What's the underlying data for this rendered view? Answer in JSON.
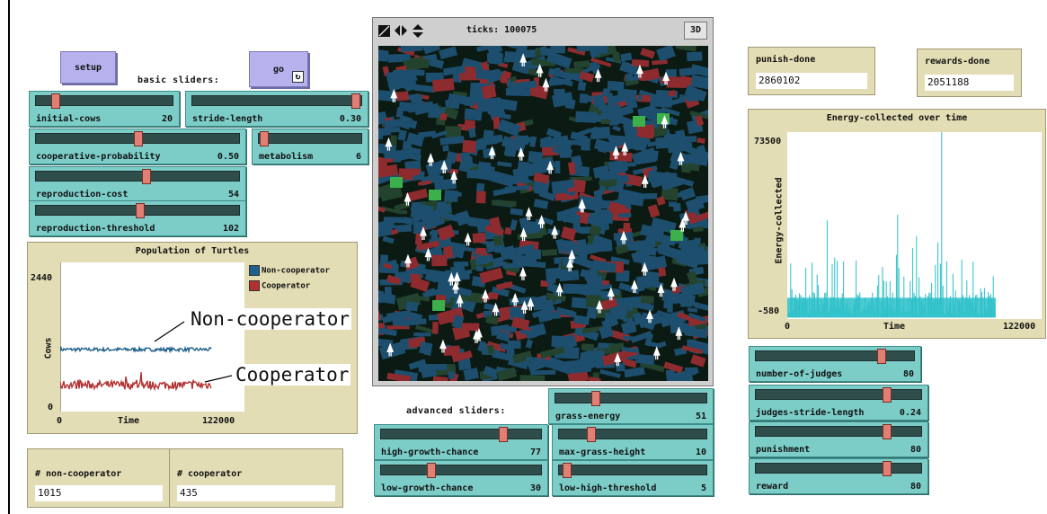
{
  "buttons": {
    "setup": "setup",
    "go": "go",
    "forever_glyph": "↻"
  },
  "notes": {
    "basic": "basic sliders:",
    "advanced": "advanced sliders:"
  },
  "sliders": {
    "initial_cows": {
      "label": "initial-cows",
      "value": "20",
      "fraction": 0.12
    },
    "stride_length": {
      "label": "stride-length",
      "value": "0.30",
      "fraction": 0.98
    },
    "cooperative_probability": {
      "label": "cooperative-probability",
      "value": "0.50",
      "fraction": 0.5
    },
    "metabolism": {
      "label": "metabolism",
      "value": "6",
      "fraction": 0.02
    },
    "reproduction_cost": {
      "label": "reproduction-cost",
      "value": "54",
      "fraction": 0.54
    },
    "reproduction_threshold": {
      "label": "reproduction-threshold",
      "value": "102",
      "fraction": 0.51
    },
    "grass_energy": {
      "label": "grass-energy",
      "value": "51",
      "fraction": 0.25
    },
    "high_growth_chance": {
      "label": "high-growth-chance",
      "value": "77",
      "fraction": 0.77
    },
    "max_grass_height": {
      "label": "max-grass-height",
      "value": "10",
      "fraction": 0.2
    },
    "low_growth_chance": {
      "label": "low-growth-chance",
      "value": "30",
      "fraction": 0.3
    },
    "low_high_threshold": {
      "label": "low-high-threshold",
      "value": "5",
      "fraction": 0.03
    },
    "number_of_judges": {
      "label": "number-of-judges",
      "value": "80",
      "fraction": 0.8
    },
    "judges_stride_length": {
      "label": "judges-stride-length",
      "value": "0.24",
      "fraction": 0.8
    },
    "punishment": {
      "label": "punishment",
      "value": "80",
      "fraction": 0.8
    },
    "reward": {
      "label": "reward",
      "value": "80",
      "fraction": 0.8
    }
  },
  "monitors": {
    "non_cooperator": {
      "label": "# non-cooperator",
      "value": "1015"
    },
    "cooperator": {
      "label": "# cooperator",
      "value": "435"
    },
    "punish_done": {
      "label": "punish-done",
      "value": "2860102"
    },
    "rewards_done": {
      "label": "rewards-done",
      "value": "2051188"
    }
  },
  "view": {
    "ticks_label": "ticks: 100075",
    "three_d": "3D"
  },
  "annotations": {
    "noncoop": "Non-cooperator",
    "coop": "Cooperator"
  },
  "chart_data": [
    {
      "type": "line",
      "title": "Population of Turtles",
      "xlabel": "Time",
      "ylabel": "Cows",
      "xlim": [
        0,
        122000
      ],
      "ylim": [
        0,
        2440
      ],
      "x_ticks": [
        "0",
        "122000"
      ],
      "y_ticks": [
        "0",
        "2440"
      ],
      "series": [
        {
          "name": "Non-cooperator",
          "color": "#1f5f8b",
          "x_end": 100000,
          "level": 1015
        },
        {
          "name": "Cooperator",
          "color": "#b33030",
          "x_end": 100000,
          "level": 435
        }
      ],
      "legend_position": "top-right"
    },
    {
      "type": "bar",
      "title": "Energy-collected over time",
      "xlabel": "Time",
      "ylabel": "Energy-collected",
      "xlim": [
        0,
        122000
      ],
      "ylim": [
        -580,
        73500
      ],
      "x_ticks": [
        "0",
        "122000"
      ],
      "y_ticks": [
        "-580",
        "73500"
      ],
      "series": [
        {
          "color": "#2bbfc8",
          "x_end": 100000,
          "peak": 73500
        }
      ]
    }
  ]
}
